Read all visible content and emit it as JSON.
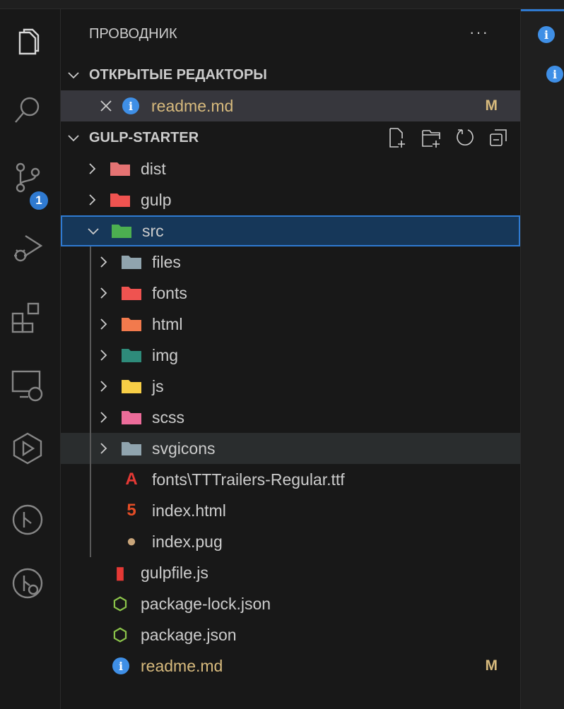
{
  "explorer": {
    "title": "ПРОВОДНИК",
    "more": "···"
  },
  "open_editors": {
    "header": "ОТКРЫТЫЕ РЕДАКТОРЫ",
    "items": [
      {
        "name": "readme.md",
        "status": "M"
      }
    ]
  },
  "scm_badge": "1",
  "workspace": {
    "header": "GULP-STARTER"
  },
  "tree": [
    {
      "label": "dist",
      "level": 0,
      "kind": "folder",
      "icon": "folder-dist-icon",
      "color": "#e57373"
    },
    {
      "label": "gulp",
      "level": 0,
      "kind": "folder",
      "icon": "folder-gulp-icon",
      "color": "#ef5350"
    },
    {
      "label": "src",
      "level": 0,
      "kind": "folder-open",
      "icon": "folder-src-icon",
      "color": "#4caf50"
    },
    {
      "label": "files",
      "level": 1,
      "kind": "folder",
      "icon": "folder-icon",
      "color": "#90a4ae"
    },
    {
      "label": "fonts",
      "level": 1,
      "kind": "folder",
      "icon": "folder-fonts-icon",
      "color": "#ef5350"
    },
    {
      "label": "html",
      "level": 1,
      "kind": "folder",
      "icon": "folder-html-icon",
      "color": "#f27a4d"
    },
    {
      "label": "img",
      "level": 1,
      "kind": "folder",
      "icon": "folder-images-icon",
      "color": "#2e8b7a"
    },
    {
      "label": "js",
      "level": 1,
      "kind": "folder",
      "icon": "folder-js-icon",
      "color": "#f7ce46"
    },
    {
      "label": "scss",
      "level": 1,
      "kind": "folder",
      "icon": "folder-sass-icon",
      "color": "#ec6c9a"
    },
    {
      "label": "svgicons",
      "level": 1,
      "kind": "folder",
      "icon": "folder-icon",
      "color": "#90a4ae"
    },
    {
      "label": "fonts\\TTTrailers-Regular.ttf",
      "level": 1,
      "kind": "file",
      "icon": "font-file-icon",
      "color": "#e53935"
    },
    {
      "label": "index.html",
      "level": 1,
      "kind": "file",
      "icon": "html5-icon",
      "color": "#e44d26"
    },
    {
      "label": "index.pug",
      "level": 1,
      "kind": "file",
      "icon": "pug-icon",
      "color": "#c9a57a"
    },
    {
      "label": "gulpfile.js",
      "level": 0,
      "kind": "file",
      "icon": "gulp-icon",
      "color": "#e53935"
    },
    {
      "label": "package-lock.json",
      "level": 0,
      "kind": "file",
      "icon": "nodejs-icon",
      "color": "#8bc34a"
    },
    {
      "label": "package.json",
      "level": 0,
      "kind": "file",
      "icon": "nodejs-icon",
      "color": "#8bc34a"
    },
    {
      "label": "readme.md",
      "level": 0,
      "kind": "file",
      "icon": "info-icon",
      "color": "#3f8fe6",
      "status": "M"
    }
  ]
}
